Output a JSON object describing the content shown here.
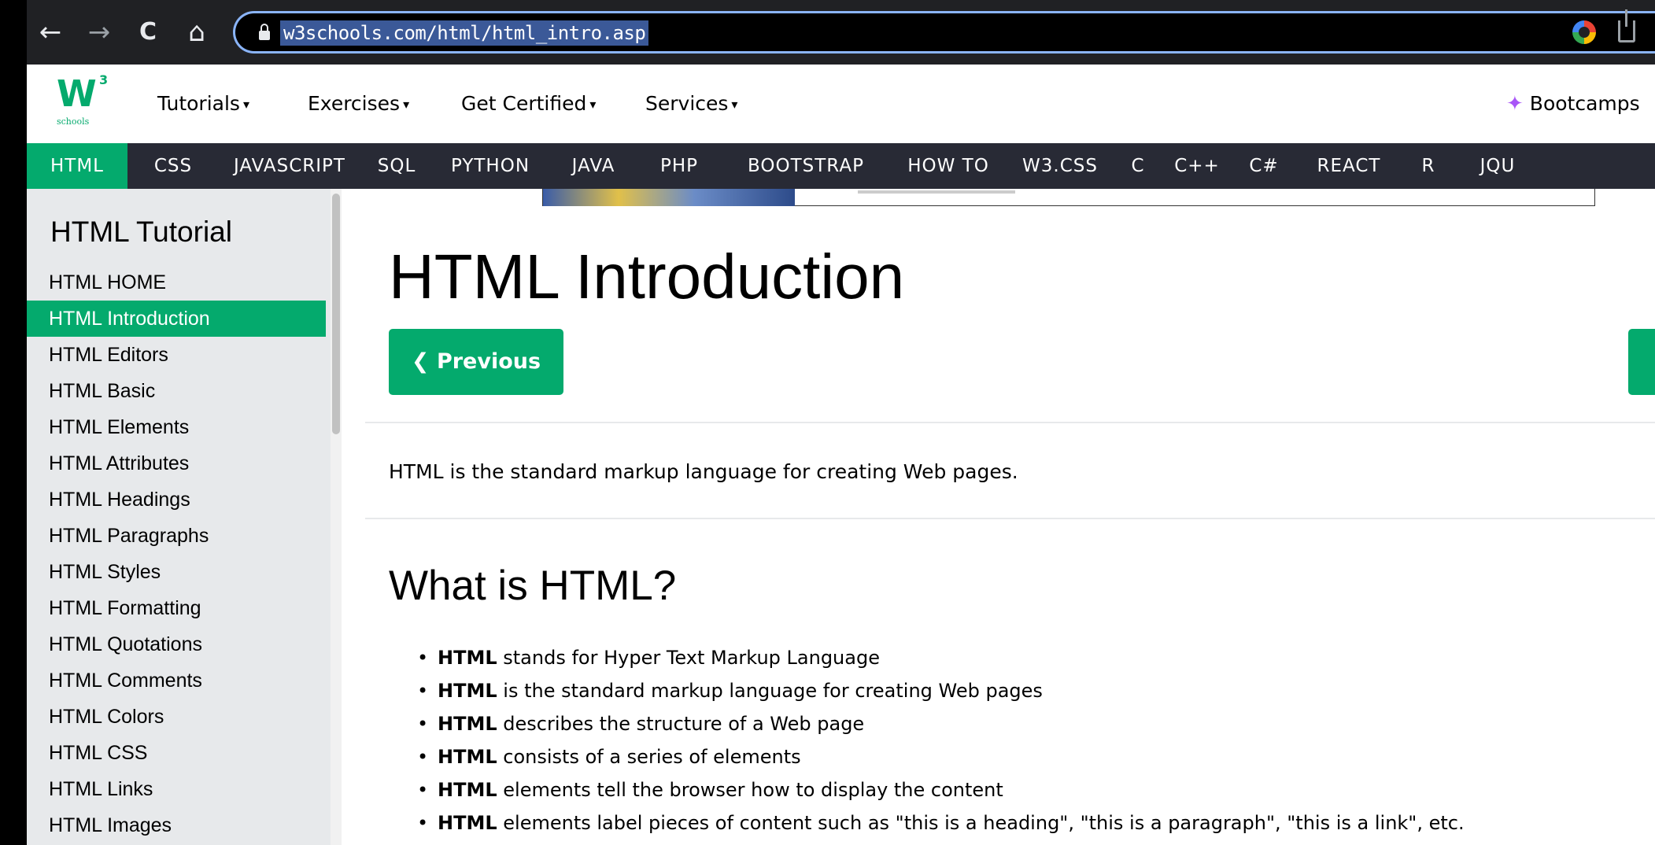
{
  "browser": {
    "url": "w3schools.com/html/html_intro.asp",
    "back_glyph": "←",
    "forward_glyph": "→",
    "reload_glyph": "C",
    "home_glyph": "⌂"
  },
  "topnav": {
    "logo_mark": "W",
    "logo_sup": "3",
    "logo_sub": "schools",
    "items": [
      {
        "label": "Tutorials",
        "caret": "▾"
      },
      {
        "label": "Exercises",
        "caret": "▾"
      },
      {
        "label": "Get Certified",
        "caret": "▾"
      },
      {
        "label": "Services",
        "caret": "▾"
      }
    ],
    "bootcamps_label": "Bootcamps"
  },
  "langbar": {
    "items": [
      "HTML",
      "CSS",
      "JAVASCRIPT",
      "SQL",
      "PYTHON",
      "JAVA",
      "PHP",
      "BOOTSTRAP",
      "HOW TO",
      "W3.CSS",
      "C",
      "C++",
      "C#",
      "REACT",
      "R",
      "JQU"
    ],
    "active_index": 0
  },
  "sidebar": {
    "title": "HTML Tutorial",
    "items": [
      "HTML HOME",
      "HTML Introduction",
      "HTML Editors",
      "HTML Basic",
      "HTML Elements",
      "HTML Attributes",
      "HTML Headings",
      "HTML Paragraphs",
      "HTML Styles",
      "HTML Formatting",
      "HTML Quotations",
      "HTML Comments",
      "HTML Colors",
      "HTML CSS",
      "HTML Links",
      "HTML Images"
    ],
    "active_index": 1
  },
  "main": {
    "title": "HTML Introduction",
    "prev_label": "❮ Previous",
    "intro": "HTML is the standard markup language for creating Web pages.",
    "section_title": "What is HTML?",
    "bullets": [
      {
        "bold": "HTML",
        "rest": " stands for Hyper Text Markup Language"
      },
      {
        "bold": "HTML",
        "rest": " is the standard markup language for creating Web pages"
      },
      {
        "bold": "HTML",
        "rest": " describes the structure of a Web page"
      },
      {
        "bold": "HTML",
        "rest": " consists of a series of elements"
      },
      {
        "bold": "HTML",
        "rest": " elements tell the browser how to display the content"
      },
      {
        "bold": "HTML",
        "rest": " elements label pieces of content such as \"this is a heading\", \"this is a paragraph\", \"this is a link\", etc."
      }
    ]
  },
  "colors": {
    "accent_green": "#04aa6d",
    "langbar_bg": "#282a35",
    "sidebar_bg": "#e7e9eb",
    "url_focus": "#8ab4f8"
  }
}
